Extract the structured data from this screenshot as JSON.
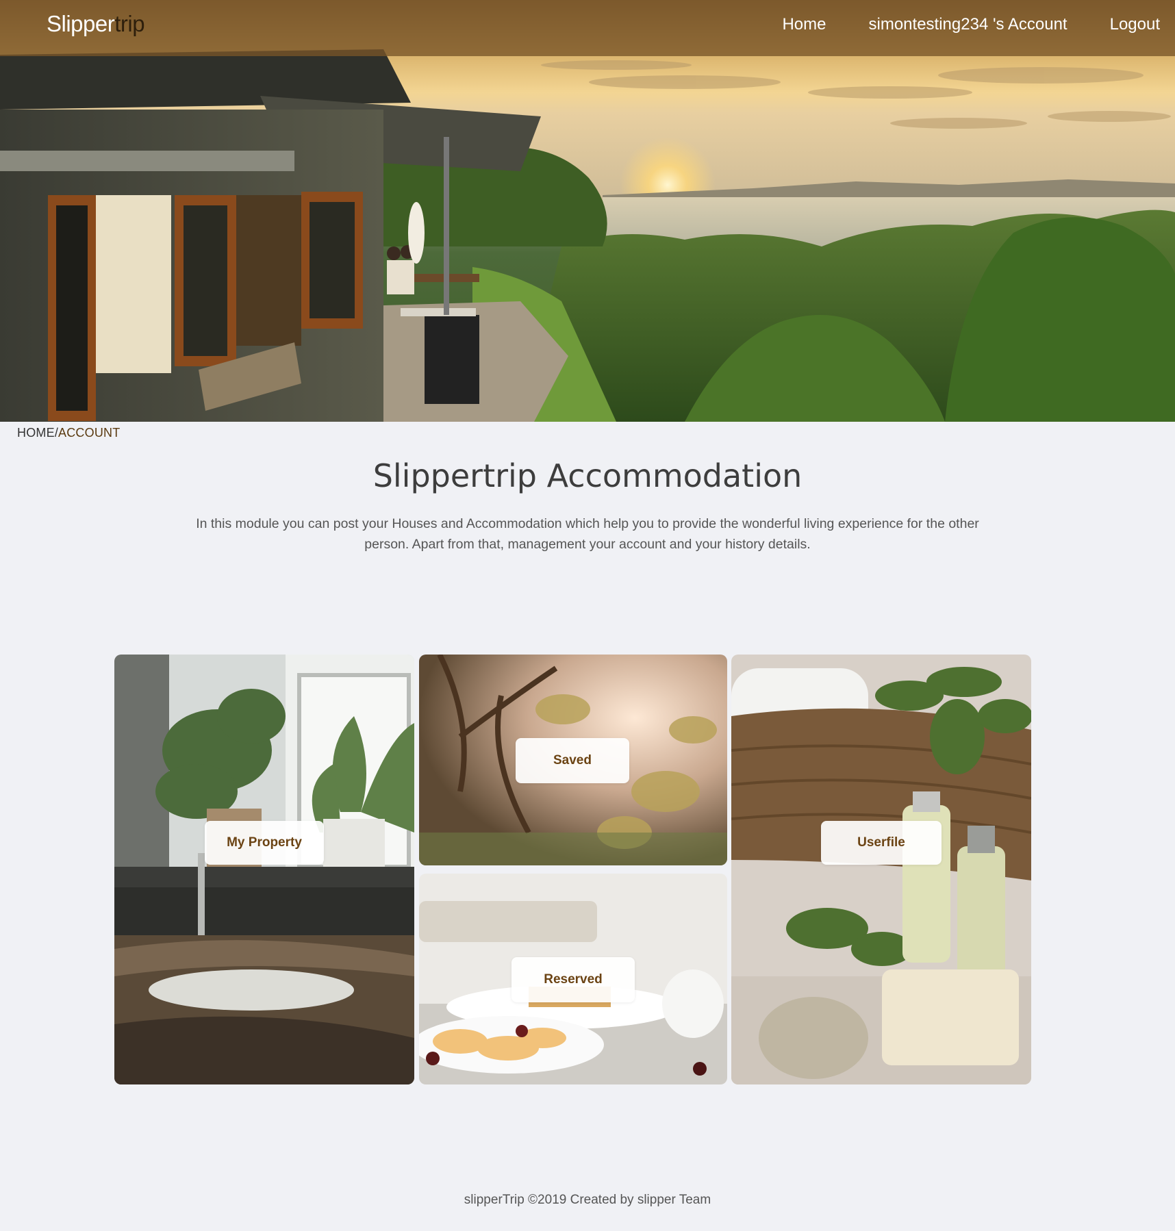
{
  "header": {
    "brand_part1": "Slipper",
    "brand_part2": "trip",
    "nav": {
      "home": "Home",
      "account": "simontesting234 's Account",
      "logout": "Logout"
    }
  },
  "breadcrumb": {
    "home": "HOME",
    "separator": "/",
    "current": "ACCOUNT"
  },
  "main": {
    "title": "Slippertrip Accommodation",
    "description": "In this module you can post your Houses and Accommodation which help you to provide the wonderful living experience for the other person. Apart from that, management your account and your history details."
  },
  "tiles": {
    "my_property": "My Property",
    "saved": "Saved",
    "reserved": "Reserved",
    "userfile": "Userfile"
  },
  "footer": {
    "text": "slipperTrip ©2019 Created by slipper Team"
  },
  "colors": {
    "navbar": "#785528",
    "brand_accent": "#2e1f0c",
    "tile_label_text": "#6b4313",
    "page_background": "#f0f1f5"
  }
}
